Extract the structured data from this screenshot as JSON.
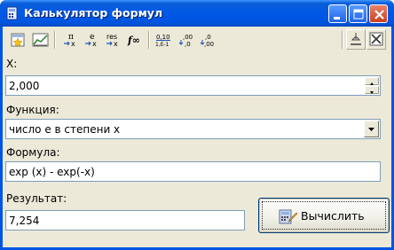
{
  "window": {
    "title": "Калькулятор формул"
  },
  "toolbar": {
    "buttons": [
      {
        "name": "new-icon"
      },
      {
        "name": "chart-icon"
      },
      {
        "name": "insert-pi",
        "top": "π",
        "bottom": "x"
      },
      {
        "name": "insert-e",
        "top": "e",
        "bottom": "x"
      },
      {
        "name": "insert-res",
        "top": "res",
        "bottom": "x"
      },
      {
        "name": "function-icon",
        "glyph": "f∞"
      },
      {
        "name": "format-scientific",
        "top": "0,10",
        "bottom": "1,E-1"
      },
      {
        "name": "decrease-decimals",
        "top": ",00",
        "bottom": ",0"
      },
      {
        "name": "increase-decimals",
        "top": ",0",
        "bottom": ",00"
      }
    ]
  },
  "x_field": {
    "label": "X:",
    "value": "2,000"
  },
  "function_field": {
    "label": "Функция:",
    "value": "число е в степени x"
  },
  "formula_field": {
    "label": "Формула:",
    "value": "exp (x) - exp(-x)"
  },
  "result_field": {
    "label": "Результат:",
    "value": "7,254"
  },
  "calc_button": {
    "label": "Вычислить"
  }
}
